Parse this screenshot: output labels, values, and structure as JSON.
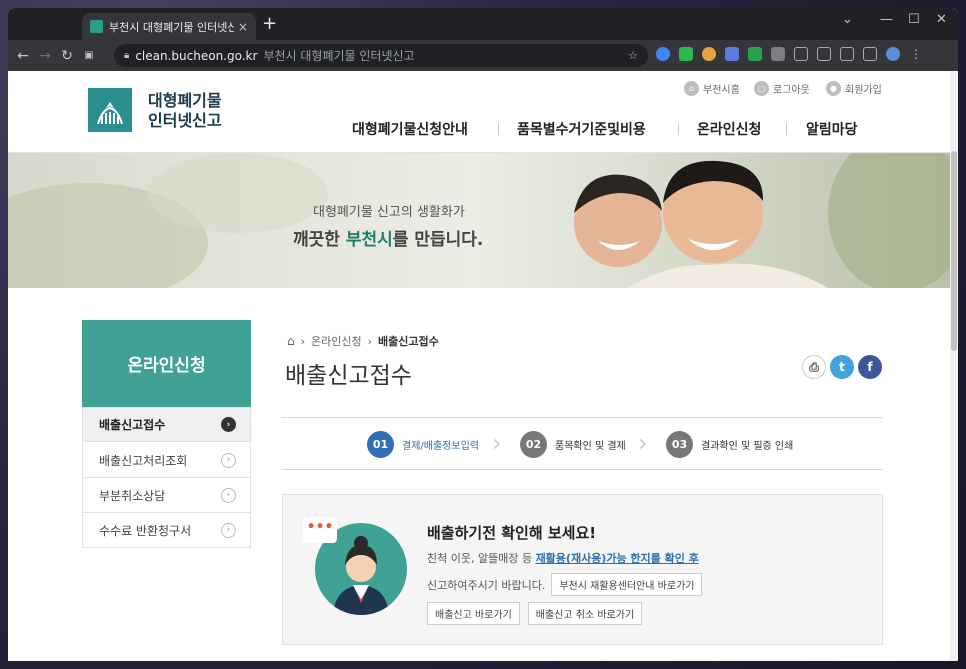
{
  "browser": {
    "tab_title": "부천시 대형폐기물 인터넷신고",
    "new_tab": "+",
    "tab_close": "×",
    "url_host": "clean.bucheon.go.kr",
    "url_title": "부천시 대형폐기물 인터넷신고",
    "controls": {
      "minimize": "—",
      "maximize": "☐",
      "close": "✕",
      "menu": "⌄"
    }
  },
  "header": {
    "logo_line1": "대형폐기물",
    "logo_line2": "인터넷신고",
    "util": {
      "home": "부천시홈",
      "logout": "로그아웃",
      "join": "회원가입"
    },
    "nav": [
      "대형폐기물신청안내",
      "품목별수거기준및비용",
      "온라인신청",
      "알림마당"
    ]
  },
  "banner": {
    "line1": "대형폐기물 신고의 생활화가",
    "line2_pre": "깨끗한 ",
    "line2_em": "부천시",
    "line2_post": "를 만듭니다."
  },
  "lnb": {
    "title": "온라인신청",
    "items": [
      "배출신고접수",
      "배출신고처리조회",
      "부분취소상담",
      "수수료 반환청구서"
    ]
  },
  "content": {
    "breadcrumb": {
      "level1": "온라인신청",
      "current": "배출신고접수"
    },
    "title": "배출신고접수",
    "steps": [
      {
        "num": "01",
        "label": "결제/배출정보입력"
      },
      {
        "num": "02",
        "label": "품목확인 및 결제"
      },
      {
        "num": "03",
        "label": "결과확인 및 필증 인쇄"
      }
    ]
  },
  "notice": {
    "bubble": "•••",
    "title": "배출하기전 확인해 보세요!",
    "l1_pre": "친척 이웃, 알뜰매장 등 ",
    "l1_link": "재활용(재사용)가능 한지를 확인 후",
    "l2": "신고하여주시기 바랍니다.",
    "btn_recycle": "부천시 재활용센터안내 바로가기",
    "btn_report": "배출신고 바로가기",
    "btn_cancel": "배출신고 취소 바로가기"
  },
  "colors": {
    "brand": "#3fa295",
    "accent": "#2f6fb3"
  }
}
